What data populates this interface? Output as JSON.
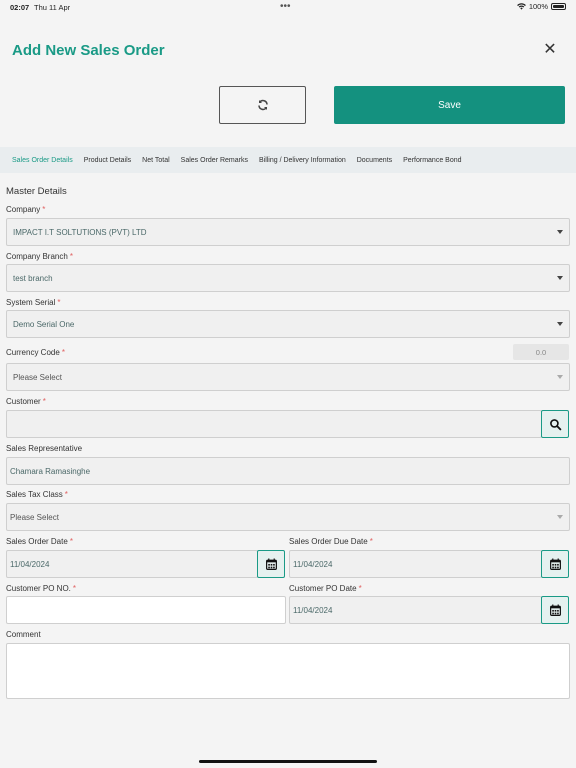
{
  "status_bar": {
    "time": "02:07",
    "date": "Thu 11 Apr",
    "dots": "•••",
    "battery": "100%"
  },
  "header": {
    "title": "Add New Sales Order",
    "close_symbol": "✕",
    "refresh_icon": "refresh-icon",
    "save_label": "Save"
  },
  "tabs": [
    {
      "label": "Sales Order Details",
      "active": true
    },
    {
      "label": "Product Details",
      "active": false
    },
    {
      "label": "Net Total",
      "active": false
    },
    {
      "label": "Sales Order Remarks",
      "active": false
    },
    {
      "label": "Billing / Delivery Information",
      "active": false
    },
    {
      "label": "Documents",
      "active": false
    },
    {
      "label": "Performance Bond",
      "active": false
    }
  ],
  "form": {
    "section_title": "Master Details",
    "required_mark": "*",
    "company": {
      "label": "Company",
      "value": "IMPACT I.T SOLTUTIONS (PVT) LTD"
    },
    "company_branch": {
      "label": "Company Branch",
      "value": "test branch"
    },
    "system_serial": {
      "label": "System Serial",
      "value": "Demo Serial One"
    },
    "currency_code": {
      "label": "Currency Code",
      "value": "Please Select",
      "rate": "0.0"
    },
    "customer": {
      "label": "Customer",
      "value": ""
    },
    "sales_representative": {
      "label": "Sales Representative",
      "value": "Chamara Ramasinghe"
    },
    "sales_tax_class": {
      "label": "Sales Tax Class",
      "value": "Please Select"
    },
    "sales_order_date": {
      "label": "Sales Order Date",
      "value": "11/04/2024"
    },
    "sales_order_due_date": {
      "label": "Sales Order Due Date",
      "value": "11/04/2024"
    },
    "customer_po_no": {
      "label": "Customer PO NO.",
      "value": ""
    },
    "customer_po_date": {
      "label": "Customer PO Date",
      "value": "11/04/2024"
    },
    "comment": {
      "label": "Comment",
      "value": ""
    }
  },
  "colors": {
    "accent": "#1a9a86",
    "save_button": "#14917f",
    "required": "#e06060"
  }
}
